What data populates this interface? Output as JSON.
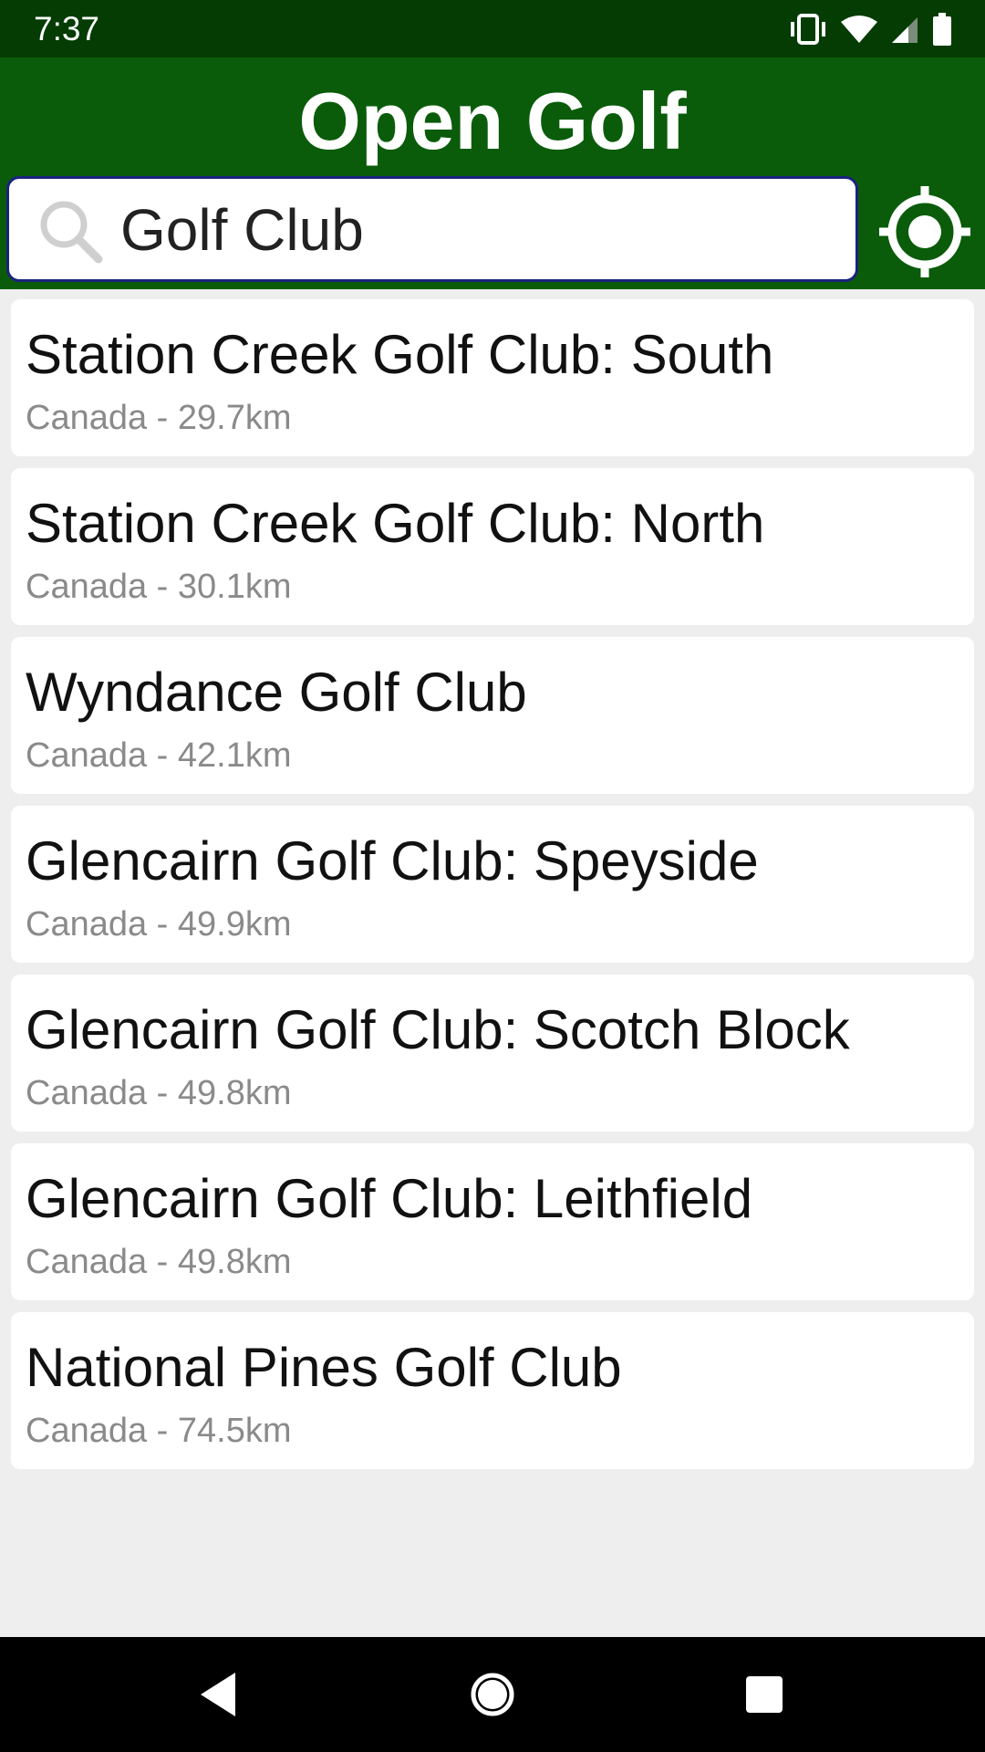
{
  "status_bar": {
    "time": "7:37",
    "icons": [
      "vibrate-icon",
      "wifi-icon",
      "cell-signal-icon",
      "battery-icon"
    ]
  },
  "app_bar": {
    "title": "Open Golf",
    "color": "#0a5c0a"
  },
  "search": {
    "value": "Golf Club",
    "icon": "search-icon"
  },
  "locate_button": {
    "icon": "my-location-icon"
  },
  "results": [
    {
      "name": "Station Creek Golf Club: South",
      "subtitle": "Canada - 29.7km"
    },
    {
      "name": "Station Creek Golf Club: North",
      "subtitle": "Canada - 30.1km"
    },
    {
      "name": "Wyndance Golf Club",
      "subtitle": "Canada - 42.1km"
    },
    {
      "name": "Glencairn Golf Club: Speyside",
      "subtitle": "Canada - 49.9km"
    },
    {
      "name": "Glencairn Golf Club: Scotch Block",
      "subtitle": "Canada - 49.8km"
    },
    {
      "name": "Glencairn Golf Club: Leithfield",
      "subtitle": "Canada - 49.8km"
    },
    {
      "name": "National Pines Golf Club",
      "subtitle": "Canada - 74.5km"
    }
  ],
  "nav_bar": {
    "icons": [
      "back-icon",
      "home-icon",
      "recents-icon"
    ]
  }
}
